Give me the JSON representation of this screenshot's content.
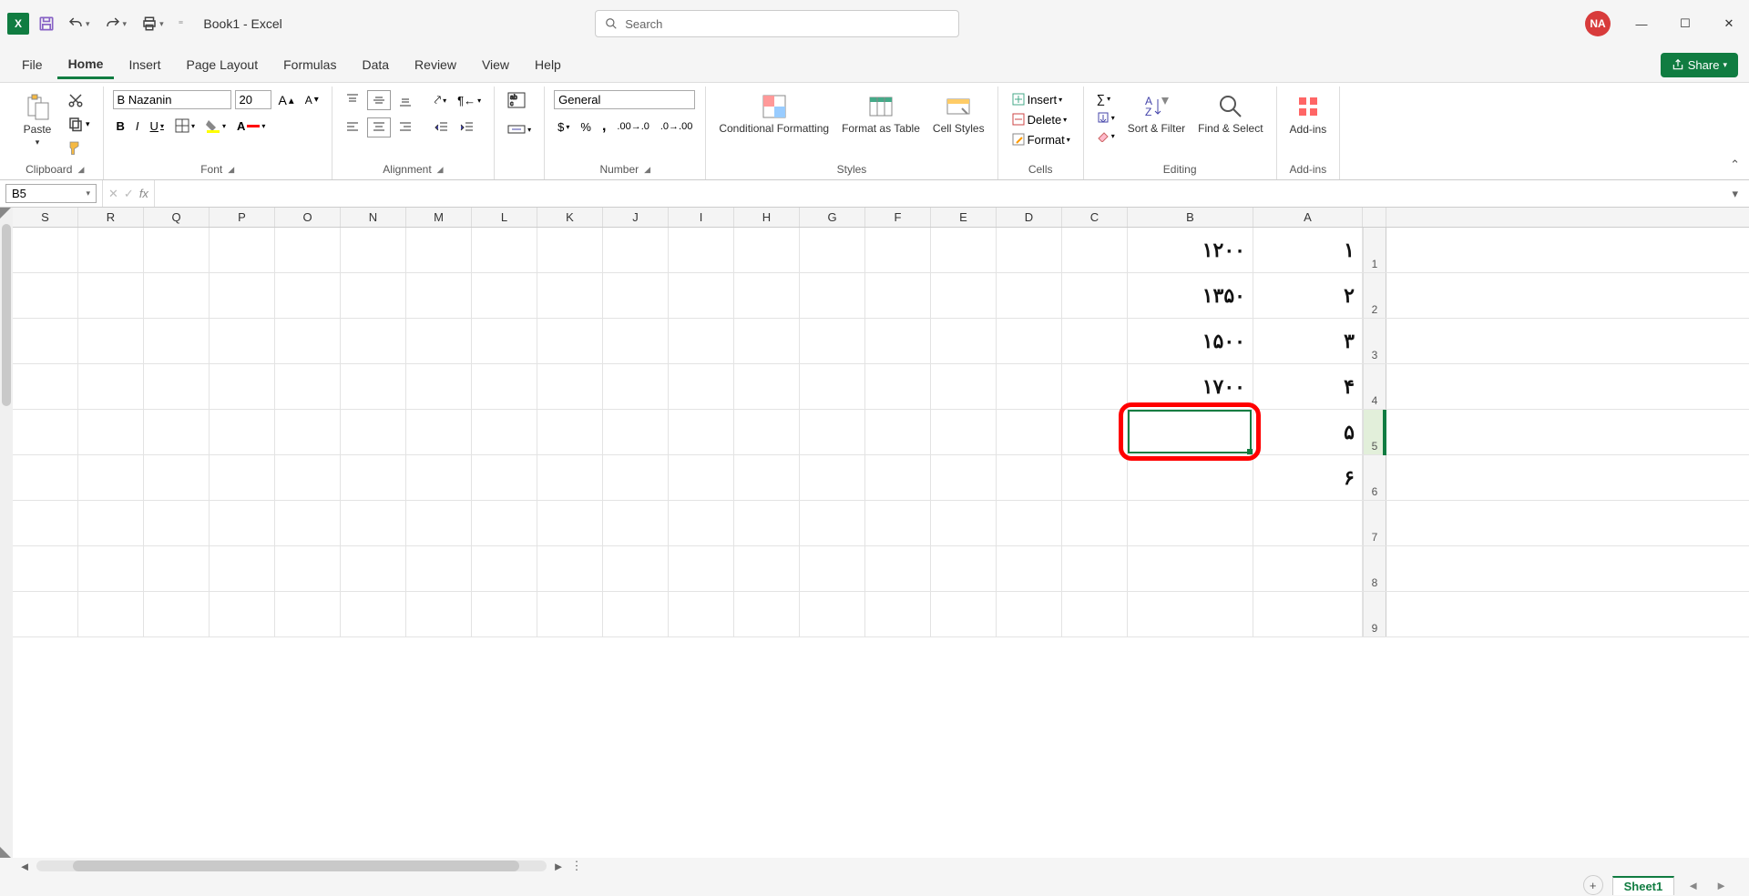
{
  "title": "Book1 - Excel",
  "search_placeholder": "Search",
  "user_initials": "NA",
  "tabs": [
    "File",
    "Home",
    "Insert",
    "Page Layout",
    "Formulas",
    "Data",
    "Review",
    "View",
    "Help"
  ],
  "active_tab": "Home",
  "share_label": "Share",
  "ribbon": {
    "clipboard": {
      "paste": "Paste",
      "label": "Clipboard"
    },
    "font": {
      "name": "B Nazanin",
      "size": "20",
      "label": "Font"
    },
    "alignment": {
      "label": "Alignment"
    },
    "number": {
      "format": "General",
      "label": "Number"
    },
    "styles": {
      "cond": "Conditional Formatting",
      "table": "Format as Table",
      "cell": "Cell Styles",
      "label": "Styles"
    },
    "cells": {
      "insert": "Insert",
      "delete": "Delete",
      "format": "Format",
      "label": "Cells"
    },
    "editing": {
      "sort": "Sort & Filter",
      "find": "Find & Select",
      "label": "Editing"
    },
    "addins": {
      "btn": "Add-ins",
      "label": "Add-ins"
    }
  },
  "namebox_value": "B5",
  "formula_value": "",
  "columns_rtl": [
    "S",
    "R",
    "Q",
    "P",
    "O",
    "N",
    "M",
    "L",
    "K",
    "J",
    "I",
    "H",
    "G",
    "F",
    "E",
    "D",
    "C",
    "B",
    "A"
  ],
  "rows": [
    {
      "n": "1",
      "A": "۱",
      "B": "۱۲۰۰"
    },
    {
      "n": "2",
      "A": "۲",
      "B": "۱۳۵۰"
    },
    {
      "n": "3",
      "A": "۳",
      "B": "۱۵۰۰"
    },
    {
      "n": "4",
      "A": "۴",
      "B": "۱۷۰۰"
    },
    {
      "n": "5",
      "A": "۵",
      "B": ""
    },
    {
      "n": "6",
      "A": "۶",
      "B": ""
    },
    {
      "n": "7",
      "A": "",
      "B": ""
    },
    {
      "n": "8",
      "A": "",
      "B": ""
    },
    {
      "n": "9",
      "A": "",
      "B": ""
    }
  ],
  "selected_cell": "B5",
  "sheet_name": "Sheet1"
}
